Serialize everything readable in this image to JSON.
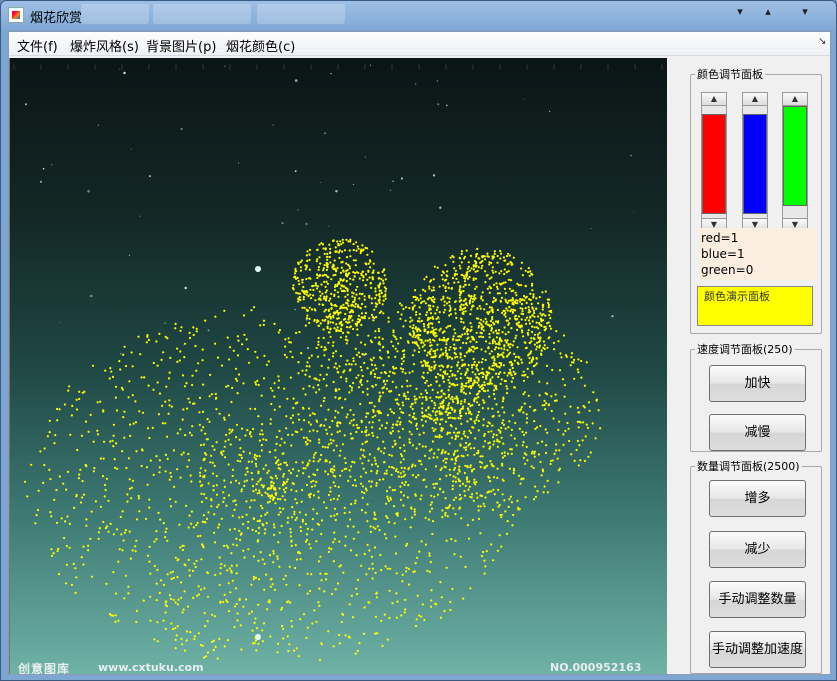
{
  "window": {
    "title": "烟花欣赏",
    "controls": {
      "minimize": "▾",
      "maximize": "▴",
      "close": "▾"
    }
  },
  "menubar": {
    "items": [
      "文件(f)",
      "爆炸风格(s)",
      "背景图片(p)",
      "烟花颜色(c)"
    ],
    "corner_glyph": "↘"
  },
  "canvas": {
    "watermark_left": "创意图库",
    "watermark_url": "www.cxtuku.com",
    "watermark_no": "NO.000952163",
    "firework_color": "#ffff00"
  },
  "color_panel": {
    "legend": "颜色调节面板",
    "sliders": [
      {
        "name": "red",
        "color": "#ff0000",
        "level": 1
      },
      {
        "name": "blue",
        "color": "#0000ff",
        "level": 1
      },
      {
        "name": "green",
        "color": "#00ff00",
        "level": 1
      }
    ],
    "readout": [
      "red=1",
      "blue=1",
      "green=0"
    ],
    "demo_legend": "颜色演示面板",
    "demo_color": "#ffff00"
  },
  "speed_panel": {
    "legend": "速度调节面板(250)",
    "buttons": [
      "加快",
      "减慢"
    ]
  },
  "count_panel": {
    "legend": "数量调节面板(2500)",
    "buttons": [
      "增多",
      "减少",
      "手动调整数量",
      "手动调整加速度"
    ]
  }
}
